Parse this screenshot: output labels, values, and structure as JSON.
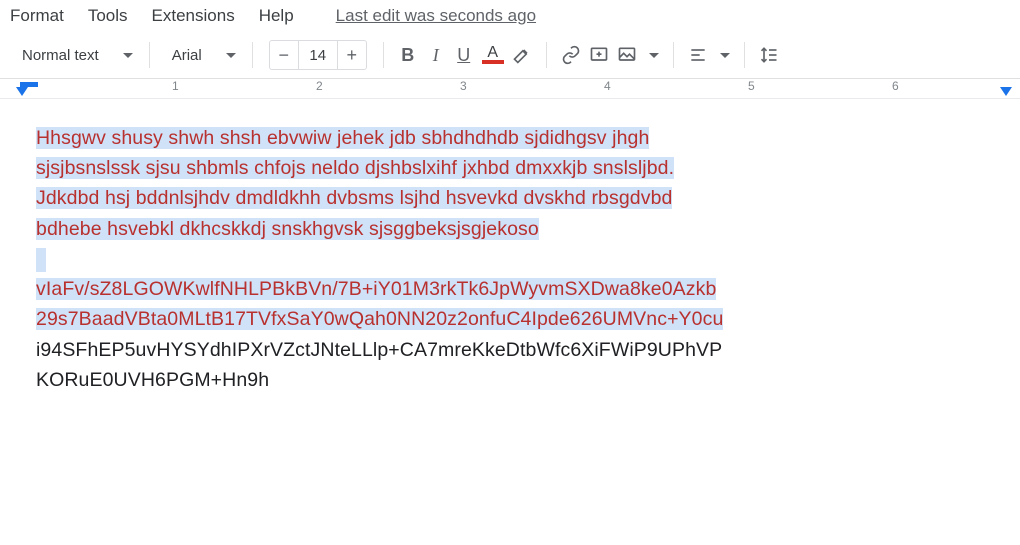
{
  "menu": {
    "format": "Format",
    "tools": "Tools",
    "extensions": "Extensions",
    "help": "Help",
    "last_edit": "Last edit was seconds ago"
  },
  "toolbar": {
    "style_label": "Normal text",
    "font_label": "Arial",
    "font_size": "14",
    "minus": "−",
    "plus": "+",
    "bold": "B",
    "italic": "I",
    "underline": "U",
    "text_color_letter": "A",
    "text_color_value": "#d93025"
  },
  "ruler": {
    "marks": [
      "1",
      "2",
      "3",
      "4",
      "5",
      "6"
    ]
  },
  "document": {
    "sel_line1": "Hhsgwv shusy shwh shsh ebvwiw jehek jdb sbhdhdhdb sjdidhgsv jhgh",
    "sel_line2": "sjsjbsnslssk sjsu shbmls chfojs neldo djshbslxihf jxhbd dmxxkjb snslsljbd.",
    "sel_line3": "Jdkdbd hsj bddnlsjhdv dmdldkhh dvbsms lsjhd hsvevkd dvskhd rbsgdvbd",
    "sel_line4": "bdhebe hsvebkl dkhcskkdj snskhgvsk sjsggbeksjsgjekoso",
    "sel_line5": "vIaFv/sZ8LGOWKwlfNHLPBkBVn/7B+iY01M3rkTk6JpWyvmSXDwa8ke0Azkb",
    "sel_line6": "29s7BaadVBta0MLtB17TVfxSaY0wQah0NN20z2onfuC4Ipde626UMVnc+Y0cu",
    "plain_line1": "i94SFhEP5uvHYSYdhIPXrVZctJNteLLlp+CA7mreKkeDtbWfc6XiFWiP9UPhVP",
    "plain_line2": "KORuE0UVH6PGM+Hn9h"
  }
}
